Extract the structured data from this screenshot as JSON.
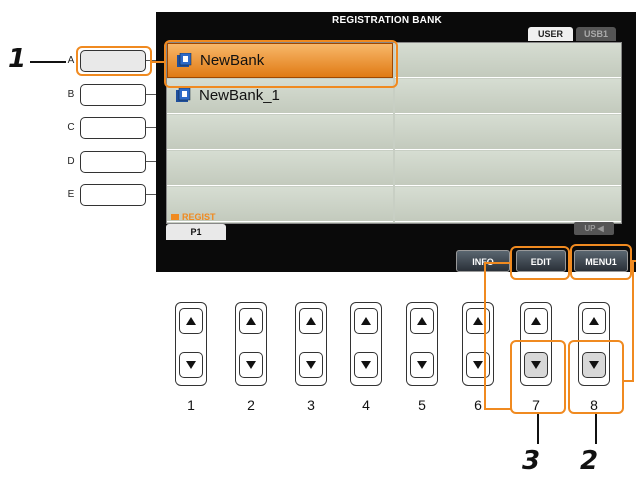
{
  "side_buttons": [
    {
      "letter": "A",
      "pressed": true
    },
    {
      "letter": "B",
      "pressed": false
    },
    {
      "letter": "C",
      "pressed": false
    },
    {
      "letter": "D",
      "pressed": false
    },
    {
      "letter": "E",
      "pressed": false
    }
  ],
  "screen": {
    "title": "REGISTRATION BANK",
    "tabs": {
      "user": "USER",
      "usb": "USB1"
    },
    "items": [
      "NewBank",
      "NewBank_1"
    ],
    "folder_label": "REGIST",
    "page_tab": "P1",
    "up_button": "UP",
    "buttons": {
      "info": "INFO",
      "edit": "EDIT",
      "menu": "MENU1"
    }
  },
  "bottom_buttons": {
    "numbers": [
      "1",
      "2",
      "3",
      "4",
      "5",
      "6",
      "7",
      "8"
    ]
  },
  "callouts": {
    "one": "1",
    "two": "2",
    "three": "3"
  },
  "colors": {
    "highlight": "#f08a20",
    "selected_cell": "#f0a040"
  }
}
